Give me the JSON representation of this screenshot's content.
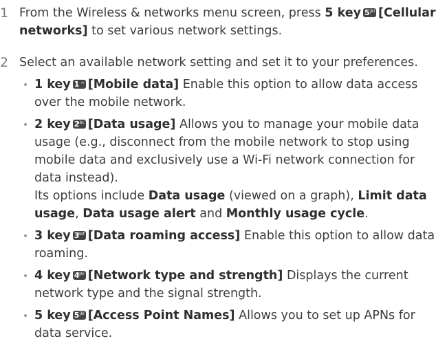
{
  "steps": [
    {
      "num": "1",
      "pre": "From the Wireless & networks menu screen, press ",
      "key_label": "5 key",
      "key_digit": "5",
      "key_letters": "jkl",
      "menu": "[Cellular networks]",
      "post": " to set various network settings."
    },
    {
      "num": "2",
      "text": "Select an available network setting and set it to your preferences."
    }
  ],
  "bullets": [
    {
      "key_label": "1 key",
      "key_digit": "1",
      "key_letters": "∞",
      "menu": "[Mobile data]",
      "desc": " Enable this option to allow data access over the mobile network."
    },
    {
      "key_label": "2 key",
      "key_digit": "2",
      "key_letters": "abc",
      "menu": "[Data usage]",
      "desc": " Allows you to manage your mobile data usage (e.g., disconnect from the mobile network to stop using mobile data and exclusively use a Wi-Fi network connection for data instead).",
      "options_pre": "Its options include ",
      "opt1": "Data usage",
      "opt1_note": " (viewed on a graph), ",
      "opt2": "Limit data usage",
      "sep1": ", ",
      "opt3": "Data usage alert",
      "and": " and ",
      "opt4": "Monthly usage cycle",
      "end": "."
    },
    {
      "key_label": "3 key",
      "key_digit": "3",
      "key_letters": "def",
      "menu": "[Data roaming access]",
      "desc": " Enable this option to allow data roaming."
    },
    {
      "key_label": "4 key",
      "key_digit": "4",
      "key_letters": "ghi",
      "menu": "[Network type and strength]",
      "desc": " Displays the current network type and the signal strength."
    },
    {
      "key_label": "5 key",
      "key_digit": "5",
      "key_letters": "jkl",
      "menu": "[Access Point Names]",
      "desc": " Allows you to set up APNs for data service."
    }
  ]
}
